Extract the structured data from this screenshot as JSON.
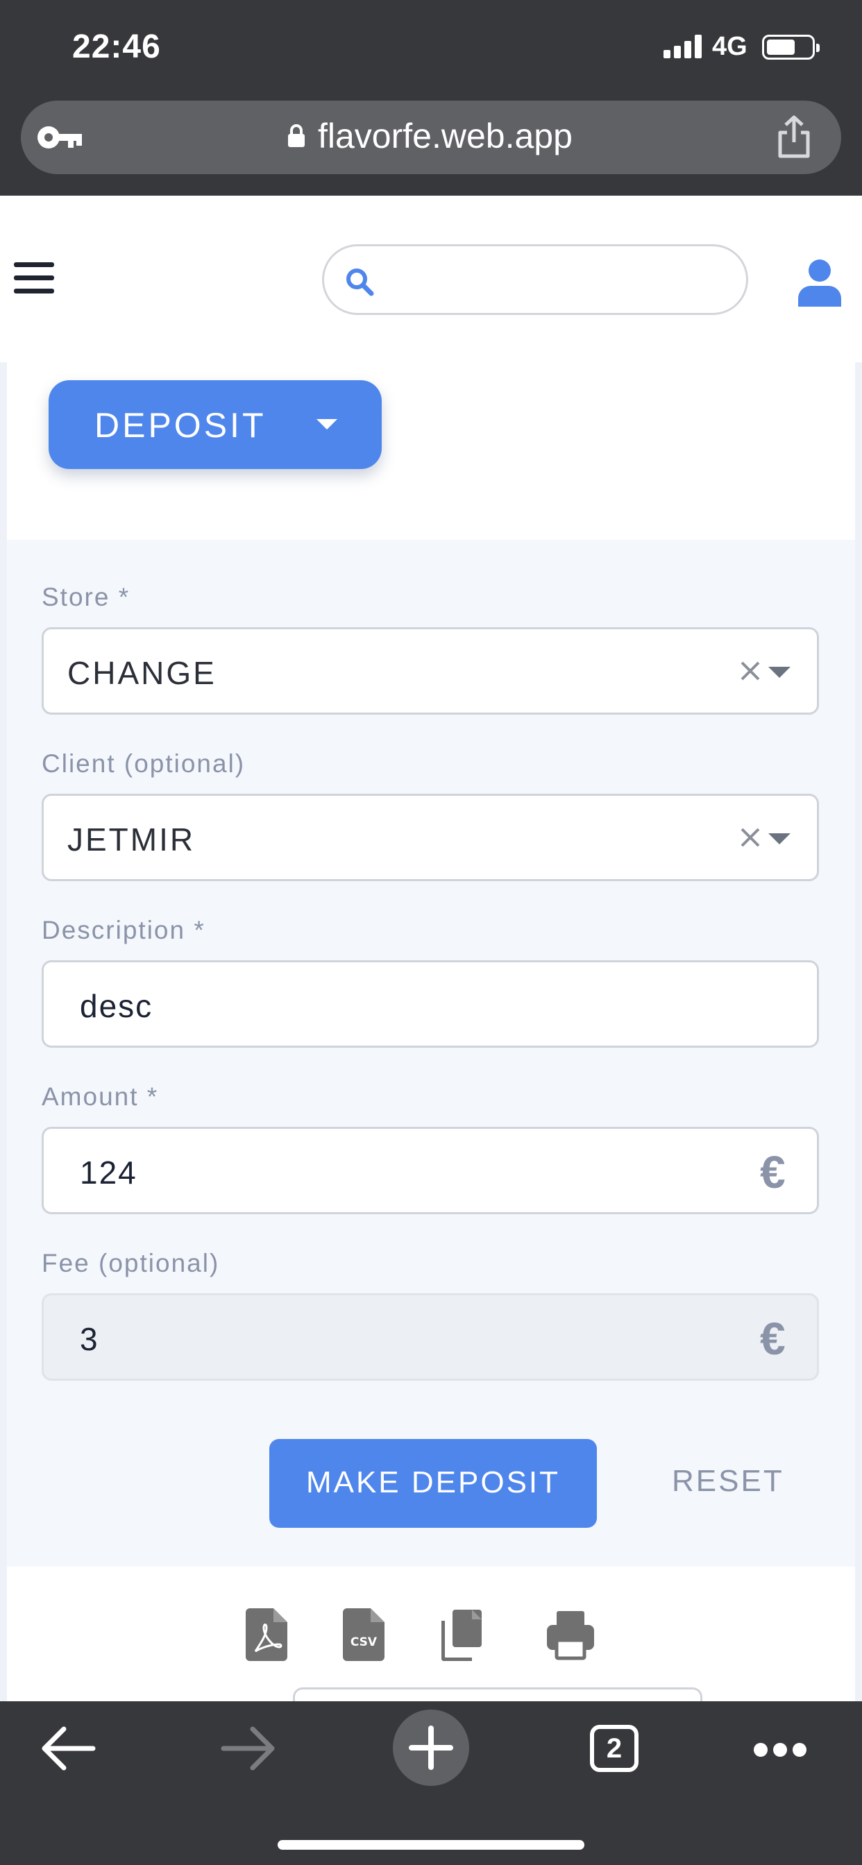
{
  "status_bar": {
    "time": "22:46",
    "network": "4G"
  },
  "browser": {
    "url": "flavorfe.web.app",
    "open_tabs": "2"
  },
  "header": {
    "search": {
      "placeholder": ""
    }
  },
  "action_menu": {
    "label": "DEPOSIT"
  },
  "form": {
    "store": {
      "label": "Store *",
      "value": "CHANGE"
    },
    "client": {
      "label": "Client (optional)",
      "value": "JETMIR"
    },
    "description": {
      "label": "Description *",
      "value": "desc"
    },
    "amount": {
      "label": "Amount *",
      "value": "124",
      "currency": "€"
    },
    "fee": {
      "label": "Fee (optional)",
      "value": "3",
      "currency": "€"
    },
    "submit_label": "MAKE DEPOSIT",
    "reset_label": "RESET"
  },
  "export_tools": [
    "pdf-icon",
    "csv-icon",
    "copy-icon",
    "print-icon"
  ],
  "colors": {
    "primary": "#4f86ec",
    "browser_chrome": "#37383b",
    "label_gray": "#8a93a8",
    "page_background": "#eef2f8"
  }
}
